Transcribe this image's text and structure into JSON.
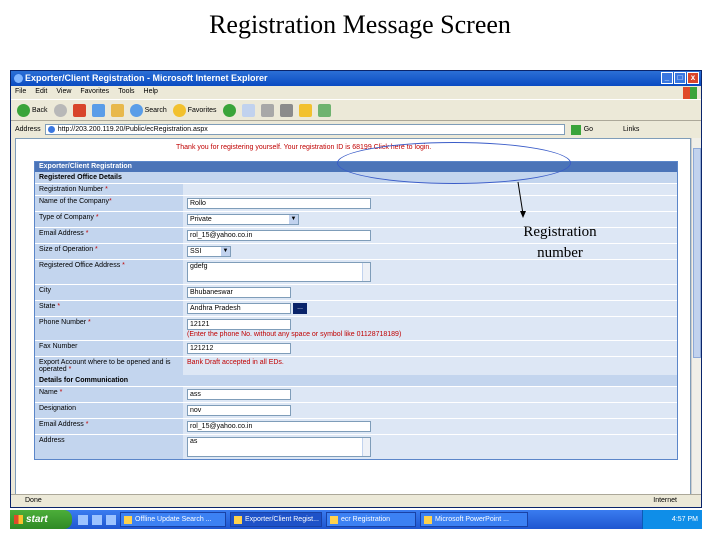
{
  "slide_title": "Registration Message Screen",
  "window": {
    "title": "Exporter/Client Registration - Microsoft Internet Explorer",
    "controls": [
      "_",
      "□",
      "x"
    ]
  },
  "menu": [
    "File",
    "Edit",
    "View",
    "Favorites",
    "Tools",
    "Help"
  ],
  "toolbar": {
    "back": "Back",
    "search": "Search",
    "favorites": "Favorites"
  },
  "address": {
    "label": "Address",
    "url": "http://203.200.119.20/Public/ecRegistration.aspx",
    "go": "Go",
    "links": "Links"
  },
  "page": {
    "thanks_message": "Thank you for registering yourself. Your registration ID is 68199 Click here to login.",
    "header": "Exporter/Client Registration",
    "section_office": "Registered Office Details",
    "section_comm": "Details for Communication",
    "fields": {
      "reg_number": "Registration Number",
      "company_name": "Name of the Company",
      "company_name_val": "Rollo",
      "company_type": "Type of Company",
      "company_type_val": "Private",
      "email": "Email Address",
      "email_val": "rol_15@yahoo.co.in",
      "op_size": "Size of Operation",
      "op_size_val": "SSI",
      "office_address": "Registered Office Address",
      "office_address_val": "gdefg",
      "city": "City",
      "city_val": "Bhubaneswar",
      "state": "State",
      "state_val": "Andhra Pradesh",
      "lookup": "...",
      "phone": "Phone Number",
      "phone_val": "12121",
      "phone_hint": "(Enter the phone No. without any space or symbol like 01128718189)",
      "fax": "Fax Number",
      "fax_val": "121212",
      "export_account": "Export Account where to be opened and is operated",
      "export_account_hint": "Bank Draft accepted in all EDs.",
      "comm_name": "Name",
      "comm_name_val": "ass",
      "designation": "Designation",
      "designation_val": "nov",
      "comm_email": "Email Address",
      "comm_email_val": "rol_15@yahoo.co.in",
      "comm_address": "Address",
      "comm_address_val": "as"
    }
  },
  "status": {
    "left": "Done",
    "zone": "Internet"
  },
  "taskbar": {
    "start": "start",
    "tasks": [
      "Offline Update Search ...",
      "Exporter/Client Regist...",
      "ecr Registration",
      "Microsoft PowerPoint ..."
    ],
    "clock": "4:57 PM"
  },
  "annotation": {
    "line1": "Registration",
    "line2": "number"
  },
  "colors": {
    "header_blue": "#4b74b8",
    "label_bg": "#c3d5ee",
    "error_red": "#c00000",
    "oval_blue": "#3a5cc8"
  }
}
